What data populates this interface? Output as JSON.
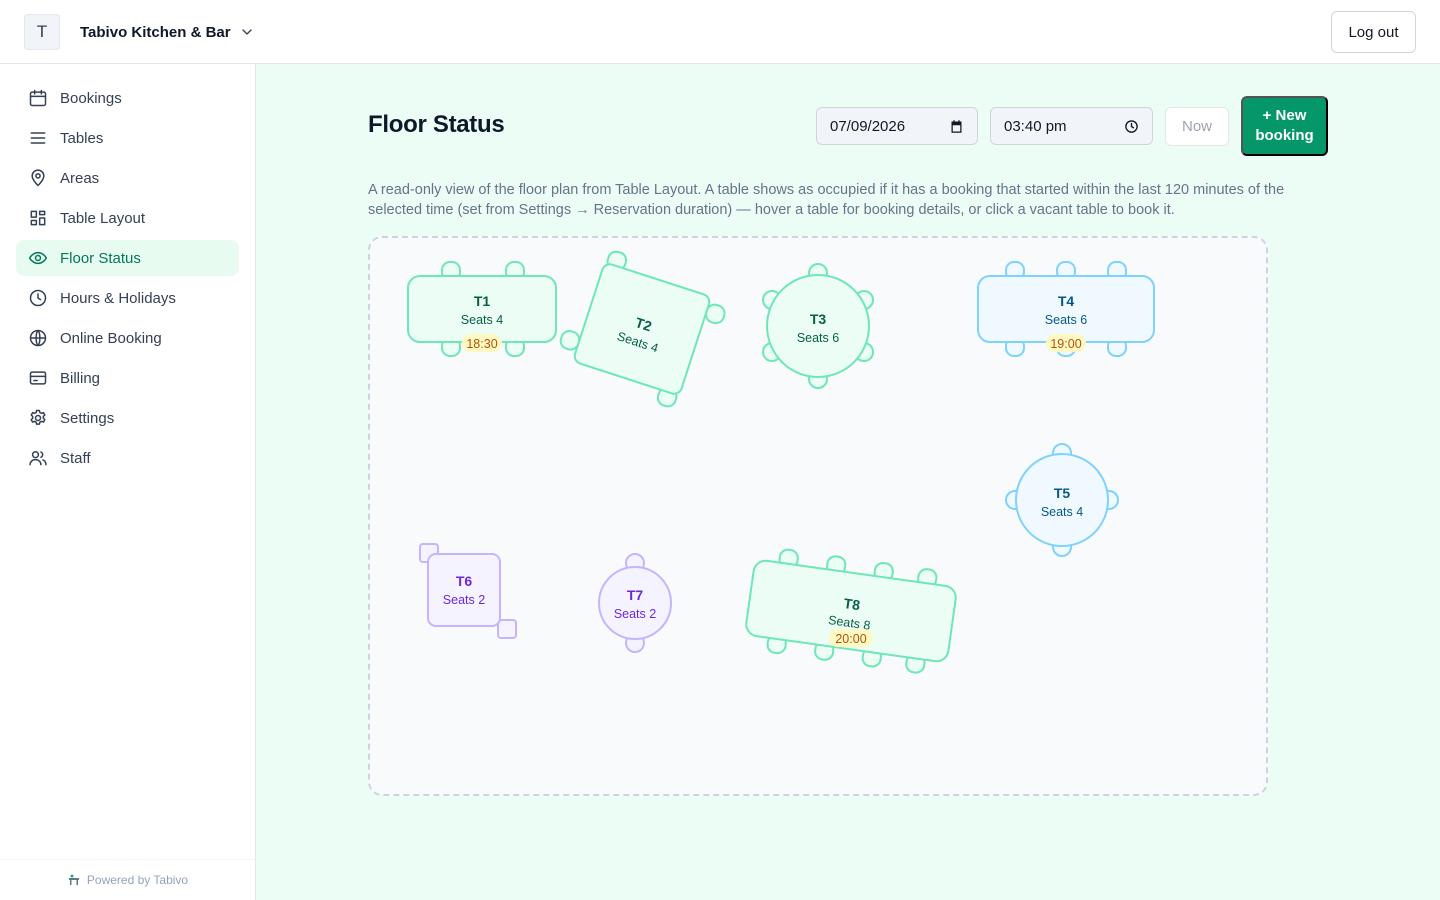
{
  "header": {
    "avatar_letter": "T",
    "restaurant_name": "Tabivo Kitchen & Bar",
    "logout_label": "Log out"
  },
  "sidebar": {
    "items": [
      {
        "label": "Bookings",
        "icon": "calendar-icon"
      },
      {
        "label": "Tables",
        "icon": "list-icon"
      },
      {
        "label": "Areas",
        "icon": "map-pin-icon"
      },
      {
        "label": "Table Layout",
        "icon": "layout-grid-icon"
      },
      {
        "label": "Floor Status",
        "icon": "eye-icon",
        "active": true
      },
      {
        "label": "Hours & Holidays",
        "icon": "clock-icon"
      },
      {
        "label": "Online Booking",
        "icon": "globe-icon"
      },
      {
        "label": "Billing",
        "icon": "credit-card-icon"
      },
      {
        "label": "Settings",
        "icon": "gear-icon"
      },
      {
        "label": "Staff",
        "icon": "users-icon"
      }
    ],
    "footer": "Powered by Tabivo"
  },
  "main": {
    "title": "Floor Status",
    "date_value": "07/09/2026",
    "time_value": "03:40 pm",
    "now_label": "Now",
    "new_booking_label": "+ New booking",
    "description": "A read-only view of the floor plan from Table Layout. A table shows as occupied if it has a booking that started within the last 120 minutes of the selected time (set from Settings → Reservation duration) — hover a table for booking details, or click a vacant table to book it."
  },
  "colors": {
    "accent": "#059669",
    "active_bg": "#e8fbf1",
    "main_bg": "#ecfdf5",
    "green_table": "#6ee7b7",
    "blue_table": "#7dd3fc",
    "purple_table": "#c4b5fd",
    "time_badge": "#fef9c3"
  },
  "tables": [
    {
      "name": "T1",
      "seats": "Seats 4",
      "booking_time": "18:30",
      "color": "green"
    },
    {
      "name": "T2",
      "seats": "Seats 4",
      "color": "green"
    },
    {
      "name": "T3",
      "seats": "Seats 6",
      "color": "green"
    },
    {
      "name": "T4",
      "seats": "Seats 6",
      "booking_time": "19:00",
      "color": "blue"
    },
    {
      "name": "T5",
      "seats": "Seats 4",
      "color": "blue"
    },
    {
      "name": "T6",
      "seats": "Seats 2",
      "color": "purple"
    },
    {
      "name": "T7",
      "seats": "Seats 2",
      "color": "purple"
    },
    {
      "name": "T8",
      "seats": "Seats 8",
      "booking_time": "20:00",
      "color": "green"
    }
  ]
}
